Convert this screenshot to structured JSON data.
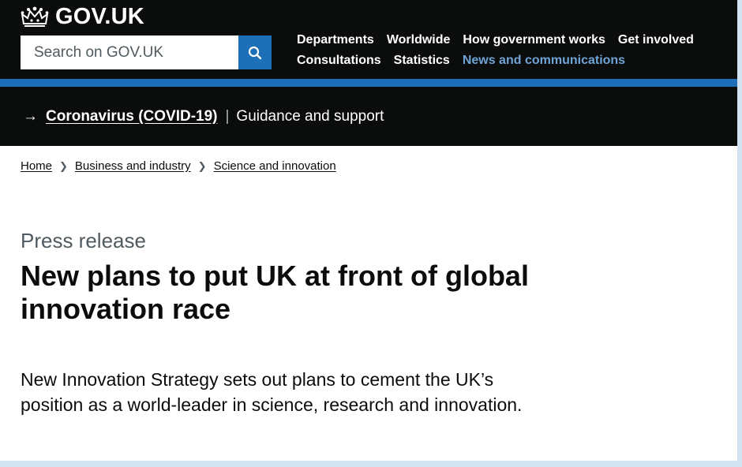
{
  "header": {
    "brand": "GOV.UK",
    "search": {
      "placeholder": "Search on GOV.UK",
      "value": ""
    },
    "nav": [
      {
        "label": "Departments"
      },
      {
        "label": "Worldwide"
      },
      {
        "label": "How government works"
      },
      {
        "label": "Get involved"
      },
      {
        "label": "Consultations"
      },
      {
        "label": "Statistics"
      },
      {
        "label": "News and communications",
        "active": true
      }
    ]
  },
  "banner": {
    "arrow": "→",
    "link": "Coronavirus (COVID-19)",
    "separator": "|",
    "text": "Guidance and support"
  },
  "breadcrumb": [
    {
      "label": "Home"
    },
    {
      "label": "Business and industry"
    },
    {
      "label": "Science and innovation"
    }
  ],
  "page": {
    "caption": "Press release",
    "title": "New plans to put UK at front of global innovation race",
    "lede": "New Innovation Strategy sets out plans to cement the UK’s position as a world-leader in science, research and innovation."
  },
  "colors": {
    "header_bg": "#0b0c0c",
    "accent_blue": "#1d70b8",
    "active_link": "#6fa4d6",
    "caption_grey": "#505a5f",
    "outer_background": "#d2e2f1"
  }
}
